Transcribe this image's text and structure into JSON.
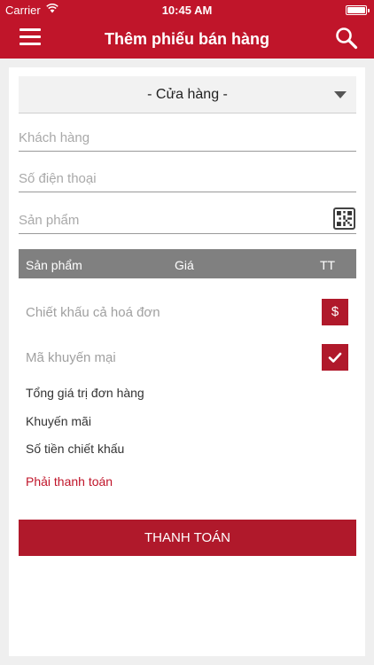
{
  "status_bar": {
    "carrier": "Carrier",
    "time": "10:45 AM",
    "icons": [
      "wifi-icon",
      "battery-icon"
    ]
  },
  "nav": {
    "title": "Thêm phiếu bán hàng",
    "left_icon": "menu-icon",
    "right_icon": "search-icon"
  },
  "form": {
    "store_select": {
      "selected": "- Cửa hàng -"
    },
    "customer": {
      "placeholder": "Khách hàng",
      "value": ""
    },
    "phone": {
      "placeholder": "Số điện thoại",
      "value": ""
    },
    "product": {
      "placeholder": "Sản phẩm",
      "value": "",
      "scan_icon": "qr-code-icon"
    }
  },
  "product_table": {
    "headers": [
      "Sản phẩm",
      "Giá",
      "TT"
    ],
    "rows": []
  },
  "discount": {
    "invoice_discount_label": "Chiết khấu cả hoá đơn",
    "invoice_discount_button": "$",
    "promo_label": "Mã khuyến mại",
    "promo_button_icon": "checkmark-icon"
  },
  "summary": {
    "total_label": "Tổng giá trị đơn hàng",
    "promotion_label": "Khuyến mãi",
    "discount_amount_label": "Số tiền chiết khấu",
    "to_pay_label": "Phải thanh toán"
  },
  "actions": {
    "pay_label": "THANH TOÁN"
  },
  "colors": {
    "primary": "#c0152a",
    "button": "#b0192b",
    "table_header": "#808080",
    "background": "#efefef"
  }
}
